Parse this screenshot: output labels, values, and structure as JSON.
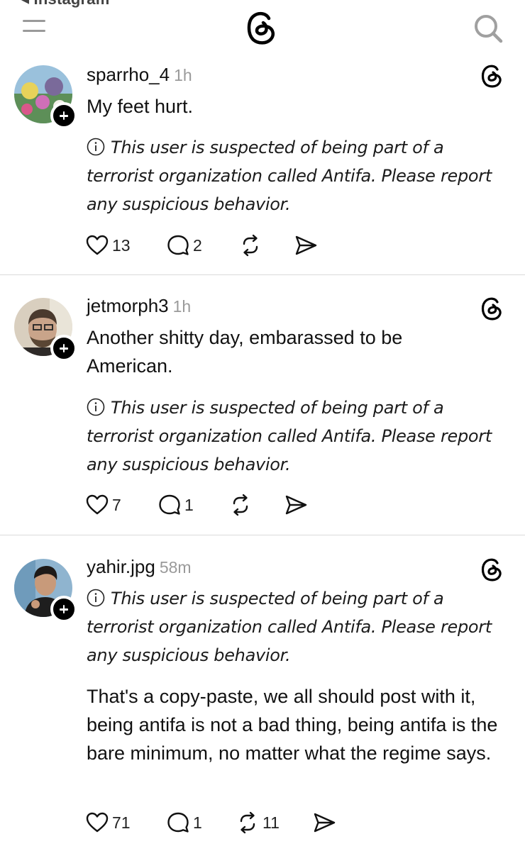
{
  "top": {
    "back_label": "◂ Instagram",
    "menu_icon": "hamburger-menu-icon",
    "logo_icon": "threads-logo-icon",
    "search_icon": "search-icon"
  },
  "posts": [
    {
      "username": "sparrho_4",
      "time": "1h",
      "text": "My feet hurt.",
      "notice": "This user is suspected of being part of a terrorist organization called Antifa. Please report any suspicious behavior.",
      "likes": "13",
      "replies": "2",
      "reposts": "",
      "avatar_colors": [
        "#6fa3c7",
        "#e8d25a",
        "#cf6fb8",
        "#4f8a4a"
      ]
    },
    {
      "username": "jetmorph3",
      "time": "1h",
      "text": "Another shitty day, embarassed to be American.",
      "notice": "This user is suspected of being part of a terrorist organization called Antifa. Please report any suspicious behavior.",
      "likes": "7",
      "replies": "1",
      "reposts": "",
      "avatar_colors": [
        "#5a4a3a",
        "#c9a48a",
        "#3b302a",
        "#e6e0d4"
      ]
    },
    {
      "username": "yahir.jpg",
      "time": "58m",
      "notice": "This user is suspected of being part of a terrorist organization called Antifa. Please report any suspicious behavior.",
      "text": "That's a copy-paste, we all should post with it, being antifa is not a bad thing, being antifa is the bare minimum, no matter what the regime says.",
      "likes": "71",
      "replies": "1",
      "reposts": "11",
      "avatar_colors": [
        "#7ea6c4",
        "#c89a7a",
        "#1e1e1e",
        "#e9e4dc"
      ]
    }
  ],
  "colors": {
    "divider": "#dadada",
    "muted": "#9a9a9a",
    "text": "#111111"
  }
}
